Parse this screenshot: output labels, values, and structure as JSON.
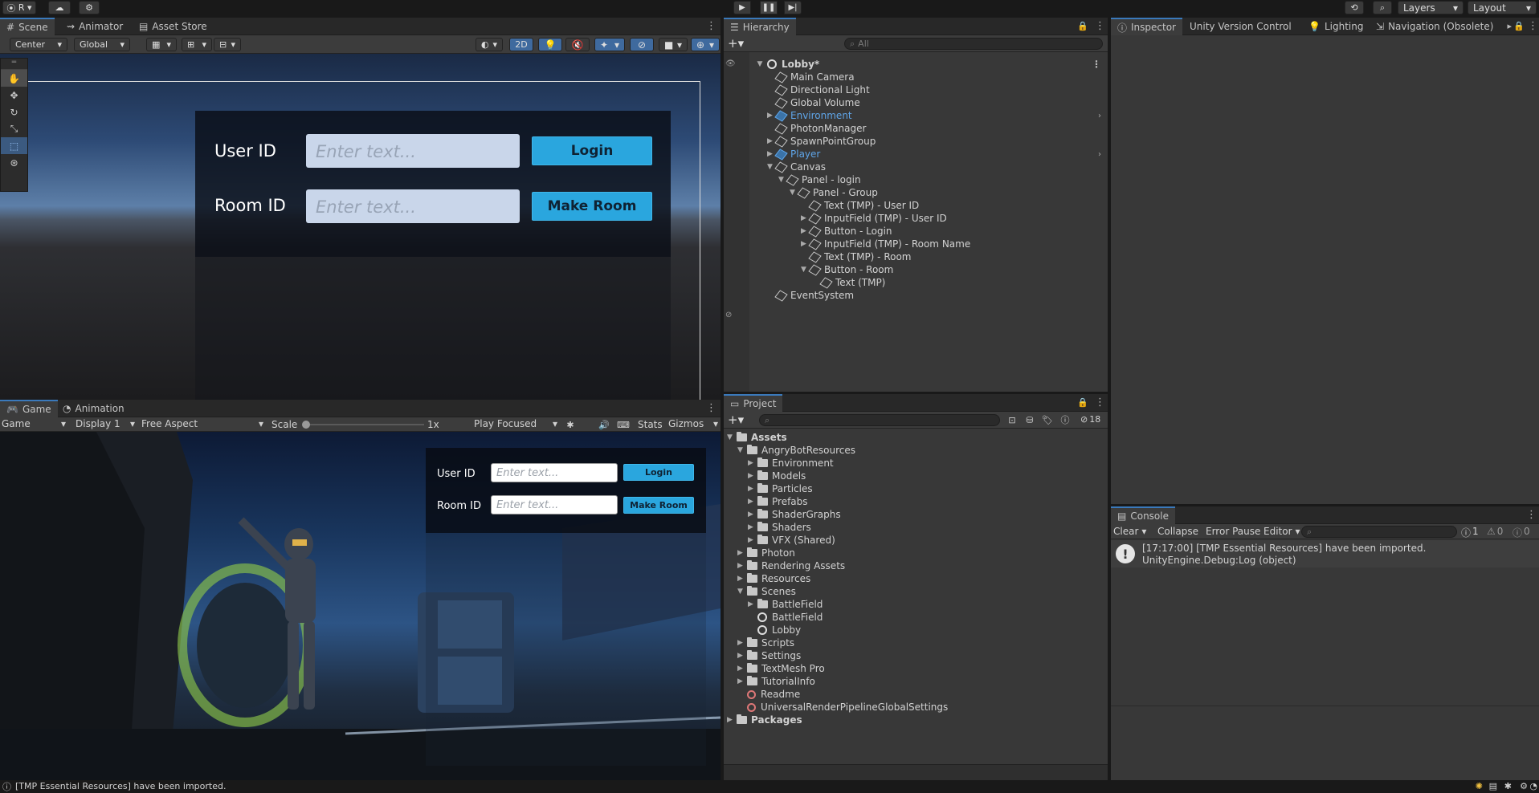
{
  "topbar": {
    "account": "R",
    "layers": "Layers",
    "layout": "Layout"
  },
  "scene": {
    "tabs": [
      "Scene",
      "Animator",
      "Asset Store"
    ],
    "pivot": "Center",
    "space": "Global",
    "mode2d": "2D",
    "ui": {
      "user_label": "User ID",
      "room_label": "Room ID",
      "placeholder": "Enter text...",
      "login": "Login",
      "make_room": "Make Room"
    }
  },
  "game": {
    "tabs": [
      "Game",
      "Animation"
    ],
    "view": "Game",
    "display": "Display 1",
    "aspect": "Free Aspect",
    "scale_label": "Scale",
    "scale_value": "1x",
    "play_mode": "Play Focused",
    "stats": "Stats",
    "gizmos": "Gizmos",
    "ui": {
      "user_label": "User ID",
      "room_label": "Room ID",
      "placeholder": "Enter text...",
      "login": "Login",
      "make_room": "Make Room"
    }
  },
  "hierarchy": {
    "title": "Hierarchy",
    "search_placeholder": "All",
    "scene_name": "Lobby*",
    "items": [
      {
        "label": "Main Camera",
        "depth": 1,
        "arrow": "",
        "blue": false
      },
      {
        "label": "Directional Light",
        "depth": 1,
        "arrow": "",
        "blue": false
      },
      {
        "label": "Global Volume",
        "depth": 1,
        "arrow": "",
        "blue": false
      },
      {
        "label": "Environment",
        "depth": 1,
        "arrow": "▶",
        "blue": true
      },
      {
        "label": "PhotonManager",
        "depth": 1,
        "arrow": "",
        "blue": false
      },
      {
        "label": "SpawnPointGroup",
        "depth": 1,
        "arrow": "▶",
        "blue": false
      },
      {
        "label": "Player",
        "depth": 1,
        "arrow": "▶",
        "blue": true
      },
      {
        "label": "Canvas",
        "depth": 1,
        "arrow": "▼",
        "blue": false
      },
      {
        "label": "Panel - login",
        "depth": 2,
        "arrow": "▼",
        "blue": false
      },
      {
        "label": "Panel - Group",
        "depth": 3,
        "arrow": "▼",
        "blue": false
      },
      {
        "label": "Text (TMP) - User ID",
        "depth": 4,
        "arrow": "",
        "blue": false
      },
      {
        "label": "InputField (TMP)  - User ID",
        "depth": 4,
        "arrow": "▶",
        "blue": false
      },
      {
        "label": "Button - Login",
        "depth": 4,
        "arrow": "▶",
        "blue": false
      },
      {
        "label": "InputField (TMP)  - Room Name",
        "depth": 4,
        "arrow": "▶",
        "blue": false
      },
      {
        "label": "Text (TMP) - Room",
        "depth": 4,
        "arrow": "",
        "blue": false
      },
      {
        "label": "Button - Room",
        "depth": 4,
        "arrow": "▼",
        "blue": false
      },
      {
        "label": "Text (TMP)",
        "depth": 5,
        "arrow": "",
        "blue": false
      },
      {
        "label": "EventSystem",
        "depth": 1,
        "arrow": "",
        "blue": false
      }
    ]
  },
  "inspector": {
    "tabs": [
      "Inspector",
      "Unity Version Control",
      "Lighting",
      "Navigation (Obsolete)"
    ]
  },
  "project": {
    "title": "Project",
    "hidden_count": "18",
    "items": [
      {
        "label": "Assets",
        "depth": 0,
        "arrow": "▼",
        "icon": "folder",
        "bold": true
      },
      {
        "label": "AngryBotResources",
        "depth": 1,
        "arrow": "▼",
        "icon": "folder",
        "bold": false
      },
      {
        "label": "Environment",
        "depth": 2,
        "arrow": "▶",
        "icon": "folder",
        "bold": false
      },
      {
        "label": "Models",
        "depth": 2,
        "arrow": "▶",
        "icon": "folder",
        "bold": false
      },
      {
        "label": "Particles",
        "depth": 2,
        "arrow": "▶",
        "icon": "folder",
        "bold": false
      },
      {
        "label": "Prefabs",
        "depth": 2,
        "arrow": "▶",
        "icon": "folder",
        "bold": false
      },
      {
        "label": "ShaderGraphs",
        "depth": 2,
        "arrow": "▶",
        "icon": "folder",
        "bold": false
      },
      {
        "label": "Shaders",
        "depth": 2,
        "arrow": "▶",
        "icon": "folder",
        "bold": false
      },
      {
        "label": "VFX (Shared)",
        "depth": 2,
        "arrow": "▶",
        "icon": "folder",
        "bold": false
      },
      {
        "label": "Photon",
        "depth": 1,
        "arrow": "▶",
        "icon": "folder",
        "bold": false
      },
      {
        "label": "Rendering Assets",
        "depth": 1,
        "arrow": "▶",
        "icon": "folder",
        "bold": false
      },
      {
        "label": "Resources",
        "depth": 1,
        "arrow": "▶",
        "icon": "folder",
        "bold": false
      },
      {
        "label": "Scenes",
        "depth": 1,
        "arrow": "▼",
        "icon": "folder",
        "bold": false
      },
      {
        "label": "BattleField",
        "depth": 2,
        "arrow": "▶",
        "icon": "folder",
        "bold": false
      },
      {
        "label": "BattleField",
        "depth": 2,
        "arrow": "",
        "icon": "unity",
        "bold": false
      },
      {
        "label": "Lobby",
        "depth": 2,
        "arrow": "",
        "icon": "unity",
        "bold": false
      },
      {
        "label": "Scripts",
        "depth": 1,
        "arrow": "▶",
        "icon": "folder",
        "bold": false
      },
      {
        "label": "Settings",
        "depth": 1,
        "arrow": "▶",
        "icon": "folder",
        "bold": false
      },
      {
        "label": "TextMesh Pro",
        "depth": 1,
        "arrow": "▶",
        "icon": "folder",
        "bold": false
      },
      {
        "label": "TutorialInfo",
        "depth": 1,
        "arrow": "▶",
        "icon": "folder",
        "bold": false
      },
      {
        "label": "Readme",
        "depth": 1,
        "arrow": "",
        "icon": "asset",
        "bold": false
      },
      {
        "label": "UniversalRenderPipelineGlobalSettings",
        "depth": 1,
        "arrow": "",
        "icon": "asset",
        "bold": false
      },
      {
        "label": "Packages",
        "depth": 0,
        "arrow": "▶",
        "icon": "folder",
        "bold": true
      }
    ]
  },
  "console": {
    "title": "Console",
    "clear": "Clear",
    "collapse": "Collapse",
    "error_pause": "Error Pause",
    "editor": "Editor",
    "count_log": "1",
    "count_warn": "0",
    "count_err": "0",
    "line1": "[17:17:00] [TMP Essential Resources] have been imported.",
    "line2": "UnityEngine.Debug:Log (object)"
  },
  "statusbar": {
    "message": "[TMP Essential Resources] have been imported."
  },
  "colors": {
    "accent": "#3a79bb",
    "button": "#2aa6de",
    "panel": "#383838",
    "selected_blue": "#5fa5e8"
  }
}
